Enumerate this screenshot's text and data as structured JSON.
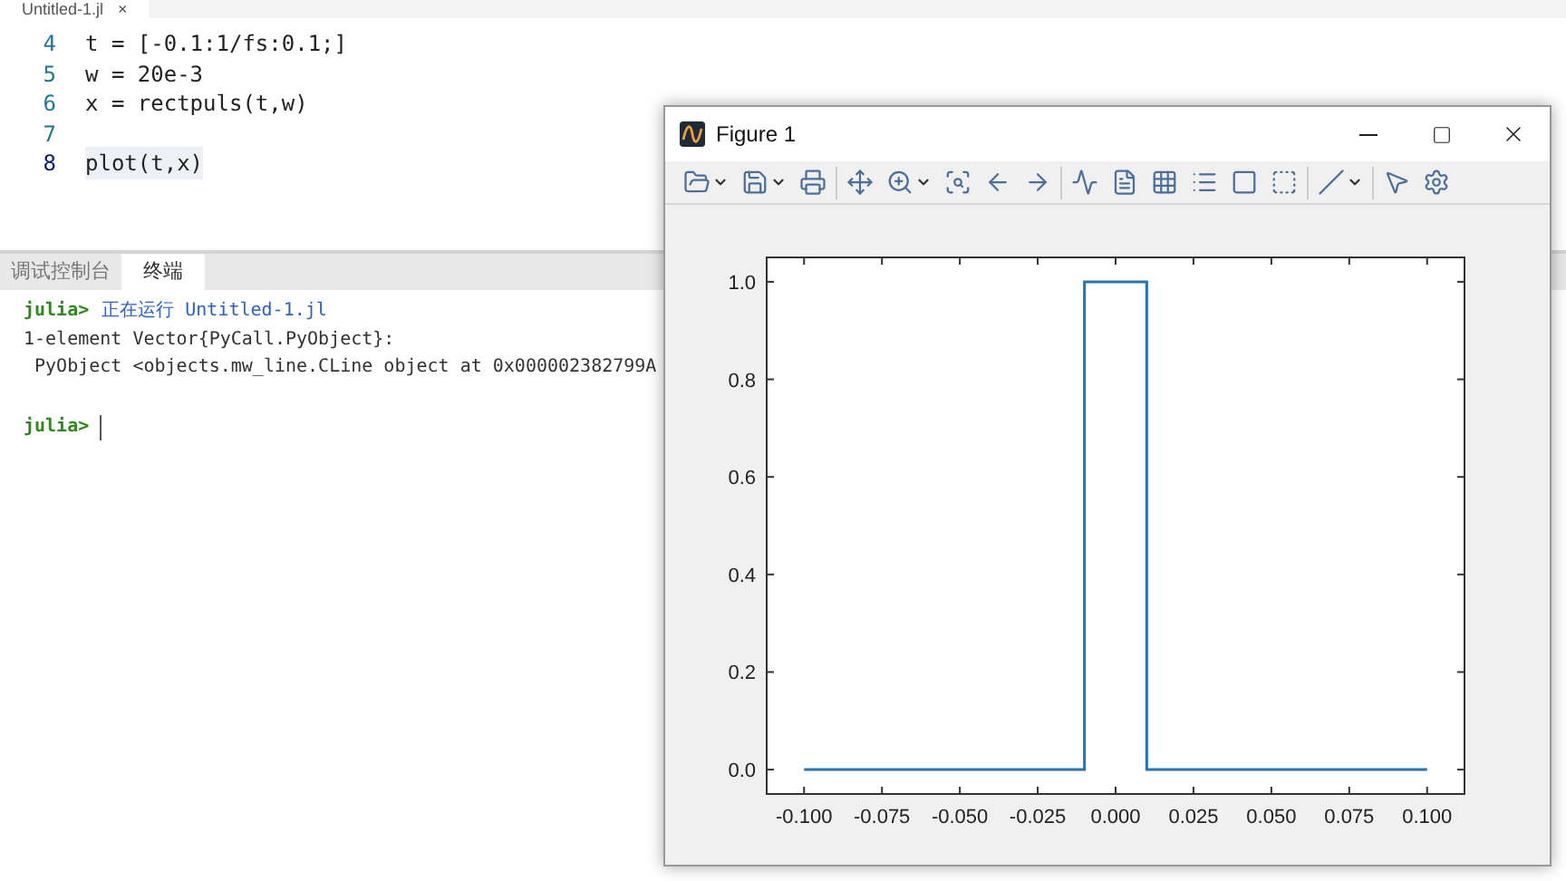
{
  "editor": {
    "tab": {
      "label": "Untitled-1.jl",
      "close": "×"
    },
    "lines": [
      {
        "number": "4",
        "code": "t = [-0.1:1/fs:0.1;]",
        "selected": false
      },
      {
        "number": "5",
        "code": "w = 20e-3",
        "selected": false
      },
      {
        "number": "6",
        "code": "x = rectpuls(t,w)",
        "selected": false
      },
      {
        "number": "7",
        "selected": false
      },
      {
        "number": "8",
        "code": "plot(t,x)",
        "selected": true
      }
    ]
  },
  "panel": {
    "tabs": [
      {
        "label": "调试控制台",
        "selected": false
      },
      {
        "label": "终端",
        "selected": true
      }
    ],
    "terminal": [
      {
        "kind": "command",
        "prompt": "julia>",
        "text": "正在运行 Untitled-1.jl"
      },
      {
        "kind": "output",
        "text": "1-element Vector{PyCall.PyObject}:"
      },
      {
        "kind": "output",
        "text": " PyObject <objects.mw_line.CLine object at 0x000002382799A"
      },
      {
        "kind": "blank"
      },
      {
        "kind": "input",
        "prompt": "julia>"
      }
    ]
  },
  "figure_window": {
    "title": "Figure 1",
    "chart_data": {
      "type": "line",
      "x": [
        -0.1,
        -0.01,
        -0.01,
        0.01,
        0.01,
        0.1
      ],
      "series": [
        {
          "color": "#1f77b4",
          "values": [
            0,
            0,
            1,
            1,
            0,
            0
          ]
        }
      ],
      "xlim": [
        -0.112,
        0.112
      ],
      "ylim": [
        -0.05,
        1.05
      ],
      "xticks": [
        {
          "value": -0.1,
          "label": "-0.100"
        },
        {
          "value": -0.075,
          "label": "-0.075"
        },
        {
          "value": -0.05,
          "label": "-0.050"
        },
        {
          "value": -0.025,
          "label": "-0.025"
        },
        {
          "value": 0,
          "label": "0.000"
        },
        {
          "value": 0.025,
          "label": "0.025"
        },
        {
          "value": 0.05,
          "label": "0.050"
        },
        {
          "value": 0.075,
          "label": "0.075"
        },
        {
          "value": 0.1,
          "label": "0.100"
        }
      ],
      "yticks": [
        {
          "value": 0,
          "label": "0.0"
        },
        {
          "value": 0.2,
          "label": "0.2"
        },
        {
          "value": 0.4,
          "label": "0.4"
        },
        {
          "value": 0.6,
          "label": "0.6"
        },
        {
          "value": 0.8,
          "label": "0.8"
        },
        {
          "value": 1,
          "label": "1.0"
        }
      ]
    }
  }
}
